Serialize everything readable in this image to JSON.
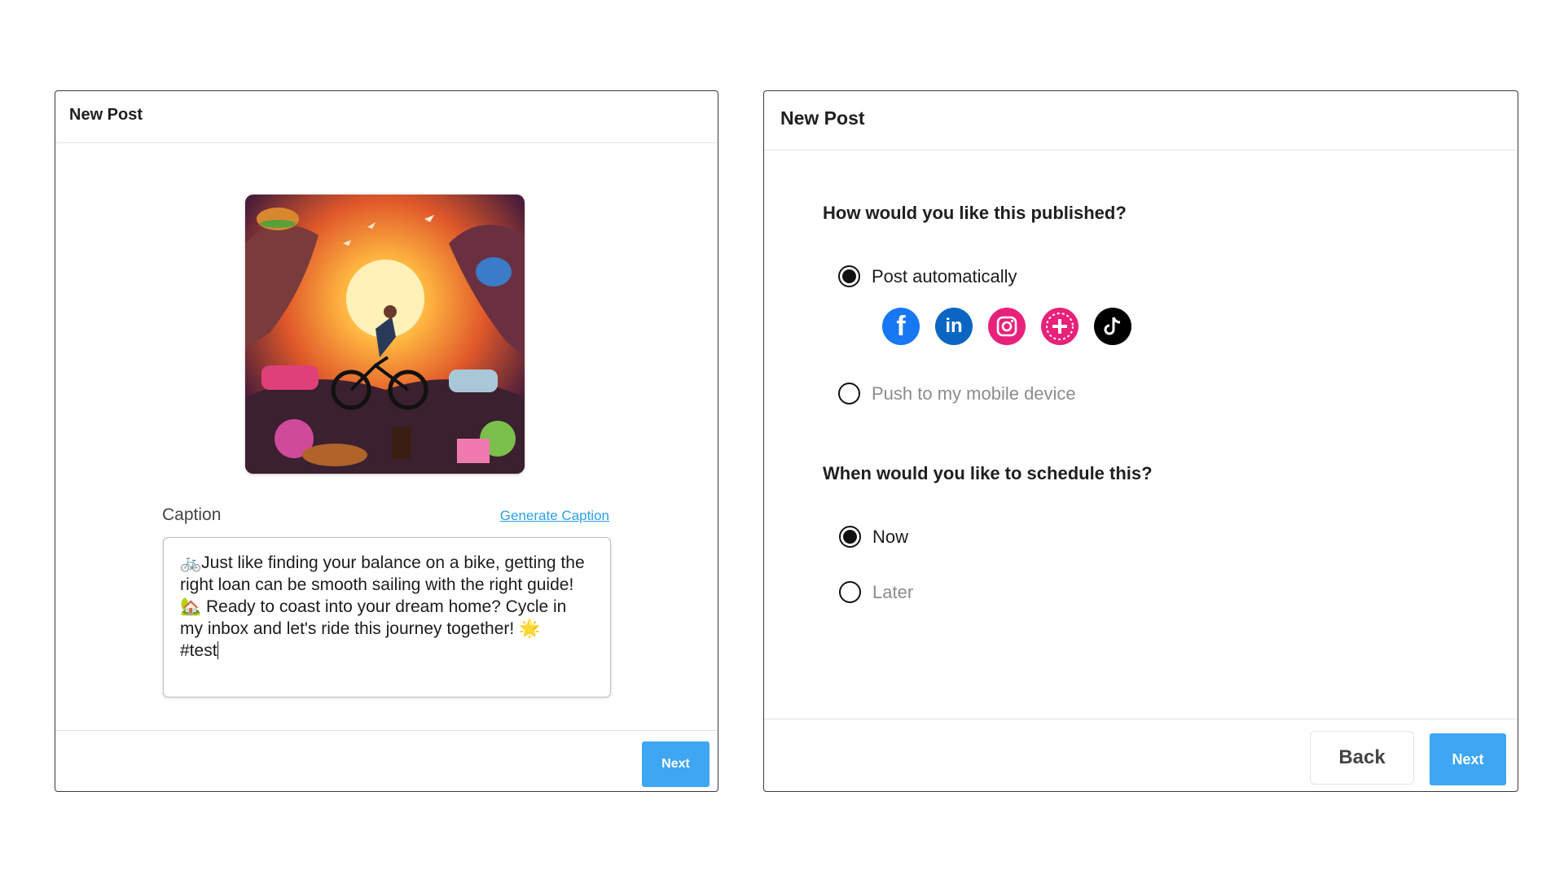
{
  "left_panel": {
    "title": "New Post",
    "caption_label": "Caption",
    "generate_caption_link": "Generate Caption",
    "caption_text": "🚲Just like finding your balance on a bike, getting the right loan can be smooth sailing with the right guide! 🏡 Ready to coast into your dream home? Cycle in my inbox and let's ride this journey together! 🌟\n#test",
    "next_label": "Next"
  },
  "right_panel": {
    "title": "New Post",
    "publish_question": "How would you like this published?",
    "publish_options": [
      {
        "label": "Post automatically",
        "selected": true
      },
      {
        "label": "Push to my mobile device",
        "selected": false
      }
    ],
    "social_icons": [
      "facebook-icon",
      "linkedin-icon",
      "instagram-icon",
      "plus-icon",
      "tiktok-icon"
    ],
    "schedule_question": "When would you like to schedule this?",
    "schedule_options": [
      {
        "label": "Now",
        "selected": true
      },
      {
        "label": "Later",
        "selected": false
      }
    ],
    "back_label": "Back",
    "next_label": "Next"
  },
  "colors": {
    "accent": "#3ea6f2",
    "link": "#2b9fe8",
    "facebook": "#1877f2",
    "linkedin": "#0a66c2",
    "instagram": "#e8217a",
    "tiktok": "#000000"
  }
}
